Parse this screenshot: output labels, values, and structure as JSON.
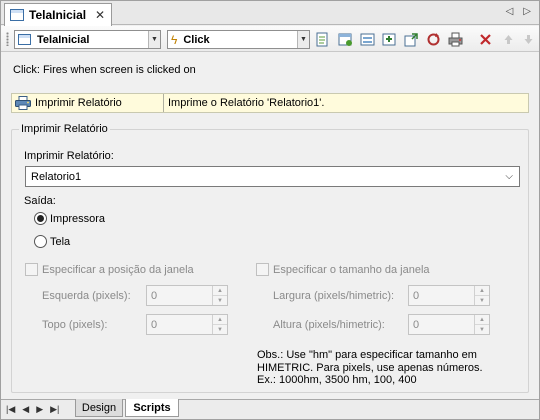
{
  "document_tab": {
    "title": "TelaInicial",
    "close": "✕"
  },
  "nav": {
    "prev": "◁",
    "next": "▷"
  },
  "toolbar": {
    "object_combo": "TelaInicial",
    "event_combo": "Click",
    "icons": [
      "new-script-icon",
      "add-script-icon",
      "script-list-icon",
      "import-icon",
      "export-icon",
      "refresh-icon",
      "print-icon",
      "delete-icon",
      "move-up-icon",
      "move-down-icon"
    ]
  },
  "event_description": "Click: Fires when screen is clicked on",
  "script_row": {
    "name": "Imprimir Relatório",
    "description": "Imprime o Relatório 'Relatorio1'."
  },
  "group": {
    "title": "Imprimir Relatório",
    "report_label": "Imprimir Relatório:",
    "report_value": "Relatorio1",
    "output_label": "Saída:",
    "output_options": [
      {
        "label": "Impressora",
        "selected": true
      },
      {
        "label": "Tela",
        "selected": false
      }
    ],
    "position_checkbox": "Especificar a posição da janela",
    "size_checkbox": "Especificar o tamanho da janela",
    "left_label": "Esquerda (pixels):",
    "left_value": "0",
    "top_label": "Topo (pixels):",
    "top_value": "0",
    "width_label": "Largura (pixels/himetric):",
    "width_value": "0",
    "height_label": "Altura (pixels/himetric):",
    "height_value": "0",
    "obs_lines": [
      "Obs.: Use \"hm\" para especificar tamanho em",
      "HIMETRIC. Para pixels, use apenas números.",
      "Ex.: 1000hm, 3500 hm, 100, 400"
    ]
  },
  "bottom_tabs": [
    {
      "label": "Design",
      "active": false
    },
    {
      "label": "Scripts",
      "active": true
    }
  ],
  "bottom_nav": [
    "|◀",
    "◀",
    "▶",
    "▶|"
  ]
}
